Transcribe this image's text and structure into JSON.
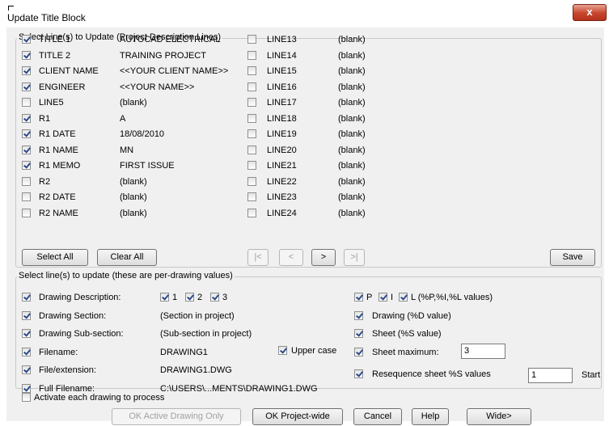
{
  "window": {
    "title": "Update Title Block",
    "close": "x"
  },
  "top_group": {
    "legend": "Select Line(s) to Update (Project Description Lines)",
    "left_rows": [
      {
        "checked": true,
        "label": "TITLE 1",
        "value": "AUTOCAD ELECTRICAL"
      },
      {
        "checked": true,
        "label": "TITLE 2",
        "value": "TRAINING PROJECT"
      },
      {
        "checked": true,
        "label": "CLIENT NAME",
        "value": "<<YOUR CLIENT NAME>>"
      },
      {
        "checked": true,
        "label": "ENGINEER",
        "value": "<<YOUR NAME>>"
      },
      {
        "checked": false,
        "label": "LINE5",
        "value": "(blank)"
      },
      {
        "checked": true,
        "label": "R1",
        "value": "A"
      },
      {
        "checked": true,
        "label": "R1 DATE",
        "value": "18/08/2010"
      },
      {
        "checked": true,
        "label": "R1 NAME",
        "value": "MN"
      },
      {
        "checked": true,
        "label": "R1 MEMO",
        "value": "FIRST ISSUE"
      },
      {
        "checked": false,
        "label": "R2",
        "value": "(blank)"
      },
      {
        "checked": false,
        "label": "R2 DATE",
        "value": "(blank)"
      },
      {
        "checked": false,
        "label": "R2 NAME",
        "value": "(blank)"
      }
    ],
    "right_rows": [
      {
        "checked": false,
        "label": "LINE13",
        "value": "(blank)"
      },
      {
        "checked": false,
        "label": "LINE14",
        "value": "(blank)"
      },
      {
        "checked": false,
        "label": "LINE15",
        "value": "(blank)"
      },
      {
        "checked": false,
        "label": "LINE16",
        "value": "(blank)"
      },
      {
        "checked": false,
        "label": "LINE17",
        "value": "(blank)"
      },
      {
        "checked": false,
        "label": "LINE18",
        "value": "(blank)"
      },
      {
        "checked": false,
        "label": "LINE19",
        "value": "(blank)"
      },
      {
        "checked": false,
        "label": "LINE20",
        "value": "(blank)"
      },
      {
        "checked": false,
        "label": "LINE21",
        "value": "(blank)"
      },
      {
        "checked": false,
        "label": "LINE22",
        "value": "(blank)"
      },
      {
        "checked": false,
        "label": "LINE23",
        "value": "(blank)"
      },
      {
        "checked": false,
        "label": "LINE24",
        "value": "(blank)"
      }
    ],
    "select_all": "Select All",
    "clear_all": "Clear All",
    "nav": {
      "first": "|<",
      "prev": "<",
      "next": ">",
      "last": ">|"
    },
    "save": "Save"
  },
  "bottom_group": {
    "legend": "Select line(s) to update (these are per-drawing values)",
    "drawing_description": {
      "checked": true,
      "label": "Drawing Description:",
      "opt1": "1",
      "opt2": "2",
      "opt3": "3",
      "opt1_checked": true,
      "opt2_checked": true,
      "opt3_checked": true
    },
    "drawing_section": {
      "checked": true,
      "label": "Drawing Section:",
      "value": "(Section in project)"
    },
    "drawing_subsection": {
      "checked": true,
      "label": "Drawing Sub-section:",
      "value": "(Sub-section in project)"
    },
    "filename": {
      "checked": true,
      "label": "Filename:",
      "value": "DRAWING1"
    },
    "upper_case": {
      "checked": true,
      "label": "Upper case"
    },
    "file_extension": {
      "checked": true,
      "label": "File/extension:",
      "value": "DRAWING1.DWG"
    },
    "full_filename": {
      "checked": true,
      "label": "Full Filename:",
      "value": "C:\\USERS\\...MENTS\\DRAWING1.DWG"
    },
    "pil": {
      "p_label": "P",
      "i_label": "I",
      "l_label": "L (%P,%I,%L values)",
      "p_checked": true,
      "i_checked": true,
      "l_checked": true
    },
    "drawing_d": {
      "checked": true,
      "label": "Drawing (%D value)"
    },
    "sheet_s": {
      "checked": true,
      "label": "Sheet (%S value)"
    },
    "sheet_max": {
      "checked": true,
      "label": "Sheet maximum:",
      "value": "3"
    },
    "resequence": {
      "checked": true,
      "label": "Resequence sheet %S values",
      "value": "1",
      "start_label": "Start"
    }
  },
  "activate": {
    "checked": false,
    "label": "Activate each drawing to process"
  },
  "footer": {
    "ok_active": "OK Active Drawing Only",
    "ok_project": "OK Project-wide",
    "cancel": "Cancel",
    "help": "Help",
    "wide": "Wide>"
  }
}
